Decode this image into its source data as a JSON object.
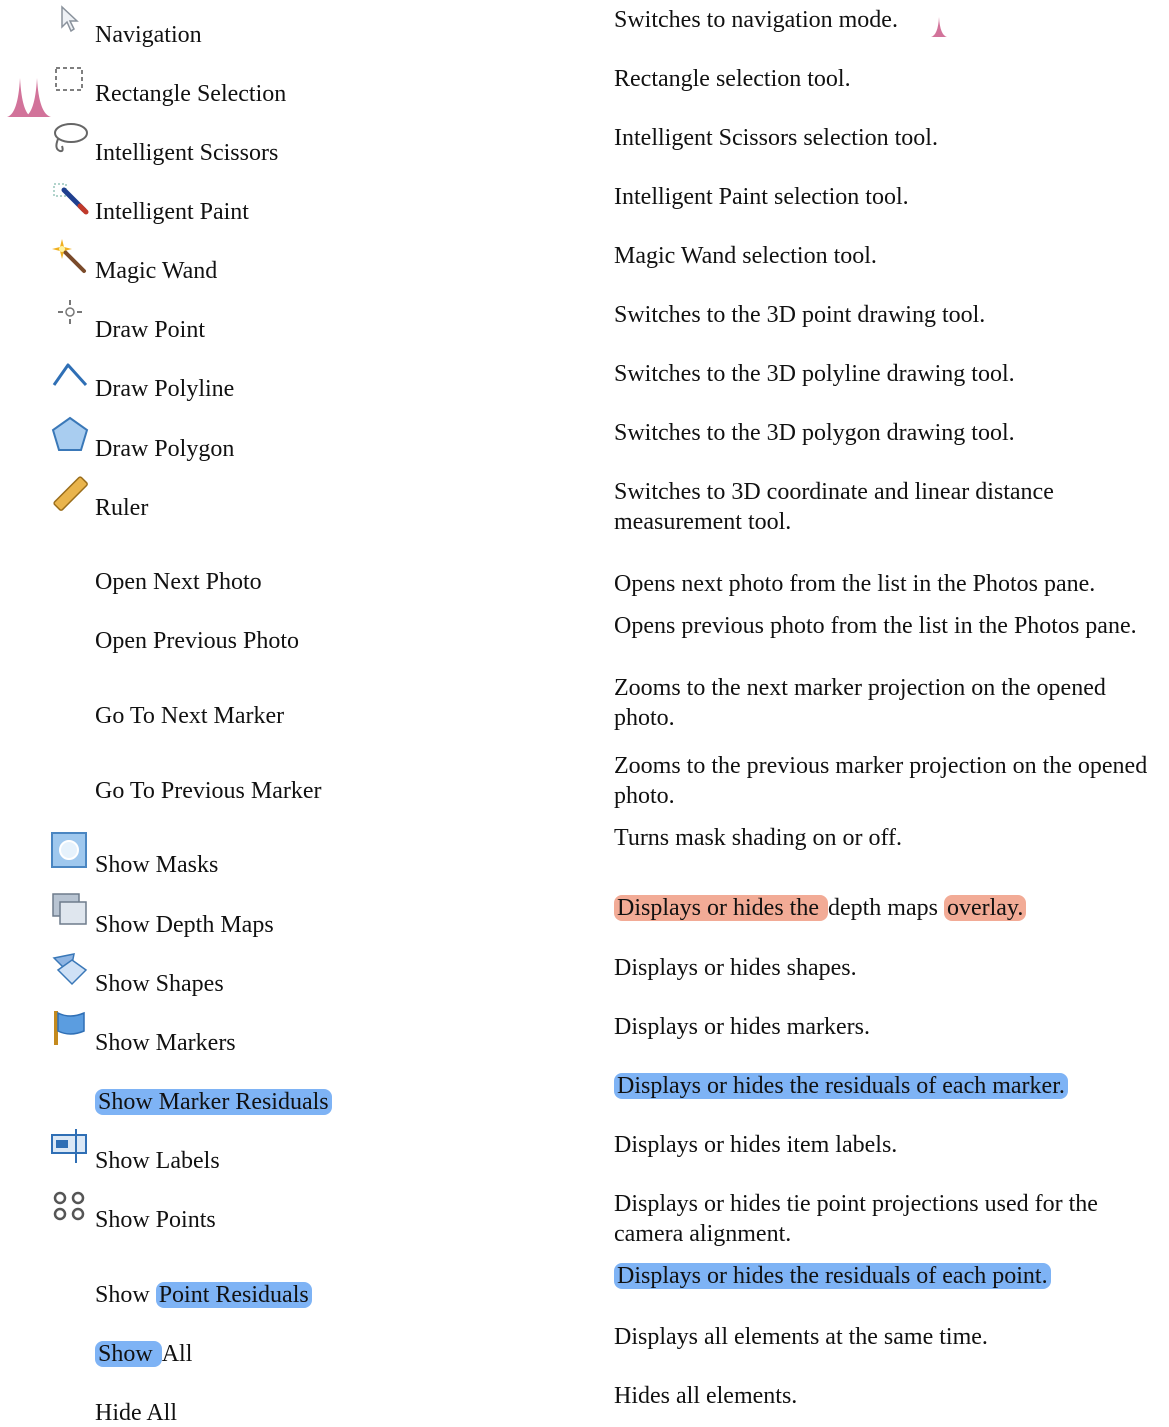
{
  "rows": [
    {
      "label": "Navigation",
      "icon": "cursor-arrow-icon",
      "desc": "Switches to navigation mode."
    },
    {
      "label": "Rectangle Selection",
      "icon": "rectangle-selection-icon",
      "desc": "Rectangle selection tool."
    },
    {
      "label": "Intelligent Scissors",
      "icon": "lasso-icon",
      "desc": "Intelligent Scissors selection tool."
    },
    {
      "label": "Intelligent Paint",
      "icon": "paint-brush-icon",
      "desc": "Intelligent Paint selection tool."
    },
    {
      "label": "Magic Wand",
      "icon": "magic-wand-icon",
      "desc": "Magic Wand selection tool."
    },
    {
      "label": "Draw Point",
      "icon": "draw-point-icon",
      "desc": "Switches to the 3D point drawing tool."
    },
    {
      "label": "Draw Polyline",
      "icon": "polyline-icon",
      "desc": "Switches to the 3D polyline drawing tool."
    },
    {
      "label": "Draw Polygon",
      "icon": "polygon-icon",
      "desc": "Switches to the 3D polygon drawing tool."
    },
    {
      "label": "Ruler",
      "icon": "ruler-icon",
      "desc": "Switches to 3D coordinate and linear distance measurement tool."
    },
    {
      "label": "Open Next Photo",
      "desc": "Opens next photo from the list in the Photos pane."
    },
    {
      "label": "Open Previous Photo",
      "desc": "Opens previous photo from the list in the Photos pane."
    },
    {
      "label": "Go To Next Marker",
      "desc": "Zooms to the next marker projection on the opened photo."
    },
    {
      "label": "Go To Previous Marker",
      "desc": "Zooms to the previous marker projection on the opened photo."
    },
    {
      "label": "Show Masks",
      "icon": "masks-icon",
      "desc": "Turns mask shading on or off."
    },
    {
      "label": "Show Depth Maps",
      "icon": "depth-maps-icon",
      "desc_parts": [
        {
          "t": "Displays or hides the ",
          "hl": "red"
        },
        {
          "t": "depth maps "
        },
        {
          "t": "overlay.",
          "hl": "red"
        }
      ]
    },
    {
      "label": "Show Shapes",
      "icon": "shapes-icon",
      "desc": "Displays or hides shapes."
    },
    {
      "label": "Show Markers",
      "icon": "marker-flag-icon",
      "desc": "Displays or hides markers."
    },
    {
      "label_parts": [
        {
          "t": "Show Marker Residuals",
          "hl": "blue"
        }
      ],
      "desc_parts": [
        {
          "t": "Displays or hides the residuals of each marker.",
          "hl": "blue"
        }
      ]
    },
    {
      "label": "Show Labels",
      "icon": "labels-icon",
      "desc": "Displays or hides item labels."
    },
    {
      "label": "Show Points",
      "icon": "points-icon",
      "desc": "Displays or hides tie point projections used for the camera alignment."
    },
    {
      "label_parts": [
        {
          "t": "Show "
        },
        {
          "t": "Point Residuals",
          "hl": "blue"
        }
      ],
      "desc_parts": [
        {
          "t": "Displays or hides the residuals of each point.",
          "hl": "blue"
        }
      ]
    },
    {
      "label_parts": [
        {
          "t": "Show ",
          "hl": "blue"
        },
        {
          "t": "All"
        }
      ],
      "desc": "Displays all elements at the same time."
    },
    {
      "label": "Hide All",
      "desc": "Hides all elements."
    }
  ]
}
